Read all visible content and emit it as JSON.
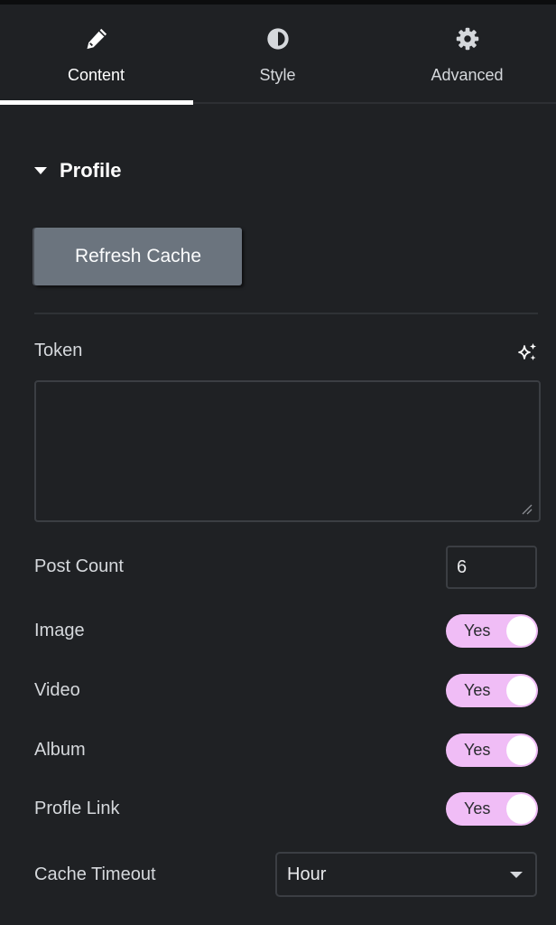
{
  "tabs": [
    {
      "label": "Content",
      "icon": "pencil-icon",
      "active": true
    },
    {
      "label": "Style",
      "icon": "half-circle-icon",
      "active": false
    },
    {
      "label": "Advanced",
      "icon": "gear-icon",
      "active": false
    }
  ],
  "section": {
    "title": "Profile",
    "expanded": true
  },
  "refresh_button": {
    "label": "Refresh Cache"
  },
  "token": {
    "label": "Token",
    "value": "",
    "ai_icon": "sparkle-icon"
  },
  "post_count": {
    "label": "Post Count",
    "value": "6"
  },
  "toggles": [
    {
      "label": "Image",
      "state": "Yes"
    },
    {
      "label": "Video",
      "state": "Yes"
    },
    {
      "label": "Album",
      "state": "Yes"
    },
    {
      "label": "Profle Link",
      "state": "Yes"
    }
  ],
  "cache_timeout": {
    "label": "Cache Timeout",
    "value": "Hour"
  },
  "colors": {
    "background": "#1f2124",
    "toggle_on": "#f0bdf6",
    "button": "#6b747e",
    "accent_underline": "#ffffff"
  }
}
